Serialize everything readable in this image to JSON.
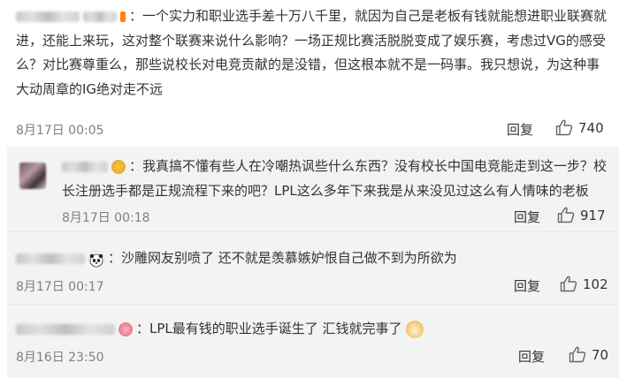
{
  "comments": [
    {
      "text": "一个实力和职业选手差十万八千里，就因为自己是老板有钱就能想进职业联赛就进，还能上来玩，这对整个联赛来说什么影响？一场正规比赛活脱脱变成了娱乐赛，考虑过VG的感受么？对比赛尊重么，那些说校长对电竞贡献的是没错，但这根本就不是一码事。我只想说，为这种事大动周章的IG绝对走不远",
      "date": "8月17日 00:05",
      "reply": "回复",
      "likes": "740"
    },
    {
      "text": "我真搞不懂有些人在冷嘲热讽些什么东西？没有校长中国电竞能走到这一步？校长注册选手都是正规流程下来的吧？LPL这么多年下来我是从来没见过这么有人情味的老板",
      "date": "8月17日 00:18",
      "reply": "回复",
      "likes": "917"
    },
    {
      "text": "沙雕网友别喷了 还不就是羡慕嫉妒恨自己做不到为所欲为",
      "date": "8月17日 00:17",
      "reply": "回复",
      "likes": "102"
    },
    {
      "text": "LPL最有钱的职业选手诞生了 汇钱就完事了",
      "date": "8月16日 23:50",
      "reply": "回复",
      "likes": "70"
    }
  ],
  "colors": {
    "date": "#808080",
    "text": "#333333",
    "subbg": "#f3f3f3"
  },
  "icons": {
    "like": "thumbs-up-icon",
    "panda": "panda-emoji-icon",
    "doge": "doge-emoji-icon",
    "badge": "vip-badge-icon"
  }
}
